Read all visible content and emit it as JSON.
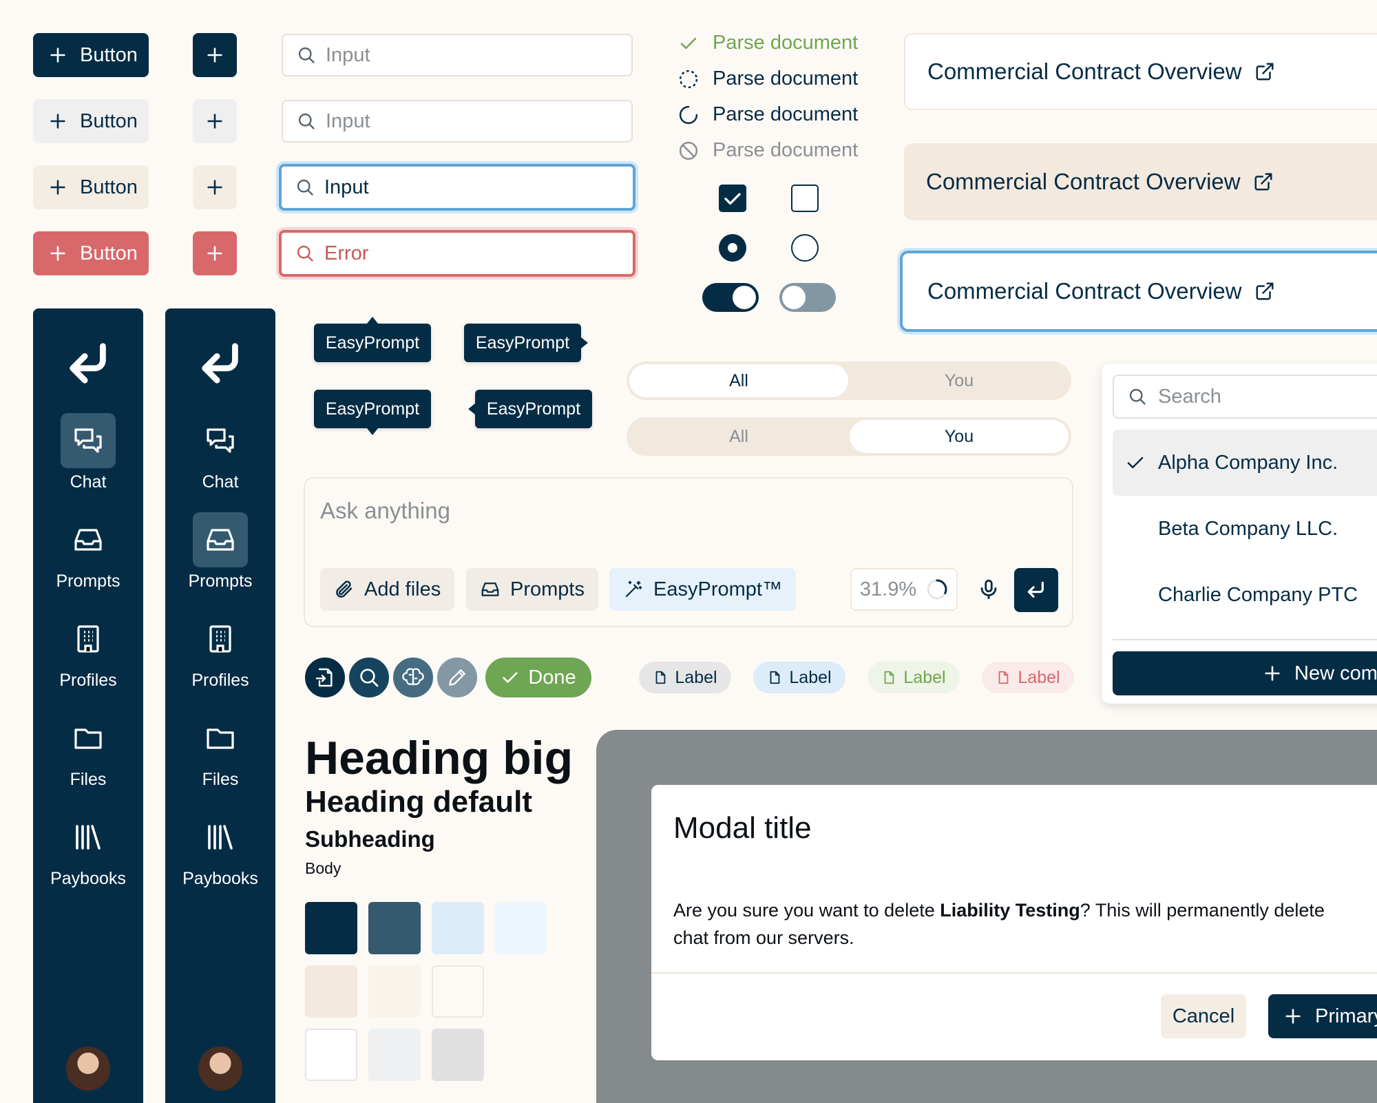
{
  "buttons": {
    "label": "Button",
    "variants": [
      "primary",
      "secondary",
      "tertiary",
      "danger"
    ]
  },
  "inputs": {
    "default_placeholder": "Input",
    "hover_placeholder": "Input",
    "focused_value": "Input",
    "error_value": "Error"
  },
  "status_list": {
    "done": "Parse document",
    "pending": "Parse document",
    "loading": "Parse document",
    "disabled": "Parse document"
  },
  "cards": {
    "title_default": "Commercial Contract Overview",
    "title_hover": "Commercial Contract Overview",
    "title_focus": "Commercial Contract Overview"
  },
  "sidebar": {
    "items": [
      {
        "label": "Chat",
        "icon": "chat-icon"
      },
      {
        "label": "Prompts",
        "icon": "inbox-icon"
      },
      {
        "label": "Profiles",
        "icon": "building-icon"
      },
      {
        "label": "Files",
        "icon": "folder-icon"
      },
      {
        "label": "Paybooks",
        "icon": "library-icon"
      }
    ]
  },
  "tooltips": {
    "top": "EasyPrompt",
    "right": "EasyPrompt",
    "bottom": "EasyPrompt",
    "left": "EasyPrompt"
  },
  "segmented": {
    "all": "All",
    "you": "You"
  },
  "composer": {
    "placeholder": "Ask anything",
    "add_files": "Add files",
    "prompts": "Prompts",
    "easyprompt": "EasyPrompt™",
    "usage": "31.9%",
    "usage_fraction": 0.319
  },
  "progress": {
    "done_label": "Done"
  },
  "labels": {
    "text": "Label"
  },
  "dropdown": {
    "search_placeholder": "Search",
    "options": [
      "Alpha Company Inc.",
      "Beta Company LLC.",
      "Charlie Company PTC"
    ],
    "selected": "Alpha Company Inc.",
    "new_button": "New com"
  },
  "typography": {
    "heading_big": "Heading big",
    "heading_default": "Heading default",
    "subheading": "Subheading",
    "body": "Body"
  },
  "palette": [
    [
      "#052c45",
      "#355a70",
      "#dcecf8",
      "#eef6fd"
    ],
    [
      "#f3e9de",
      "#f9f3ec",
      "#fdfaf6"
    ],
    [
      "#ffffff",
      "#eff0f1",
      "#e0e0e0"
    ]
  ],
  "modal": {
    "title": "Modal title",
    "body_prefix": "Are you sure you want to delete ",
    "body_bold": "Liability Testing",
    "body_suffix": "? This will permanently delete",
    "body_line2": "chat from our servers.",
    "cancel": "Cancel",
    "primary": "Primary"
  }
}
